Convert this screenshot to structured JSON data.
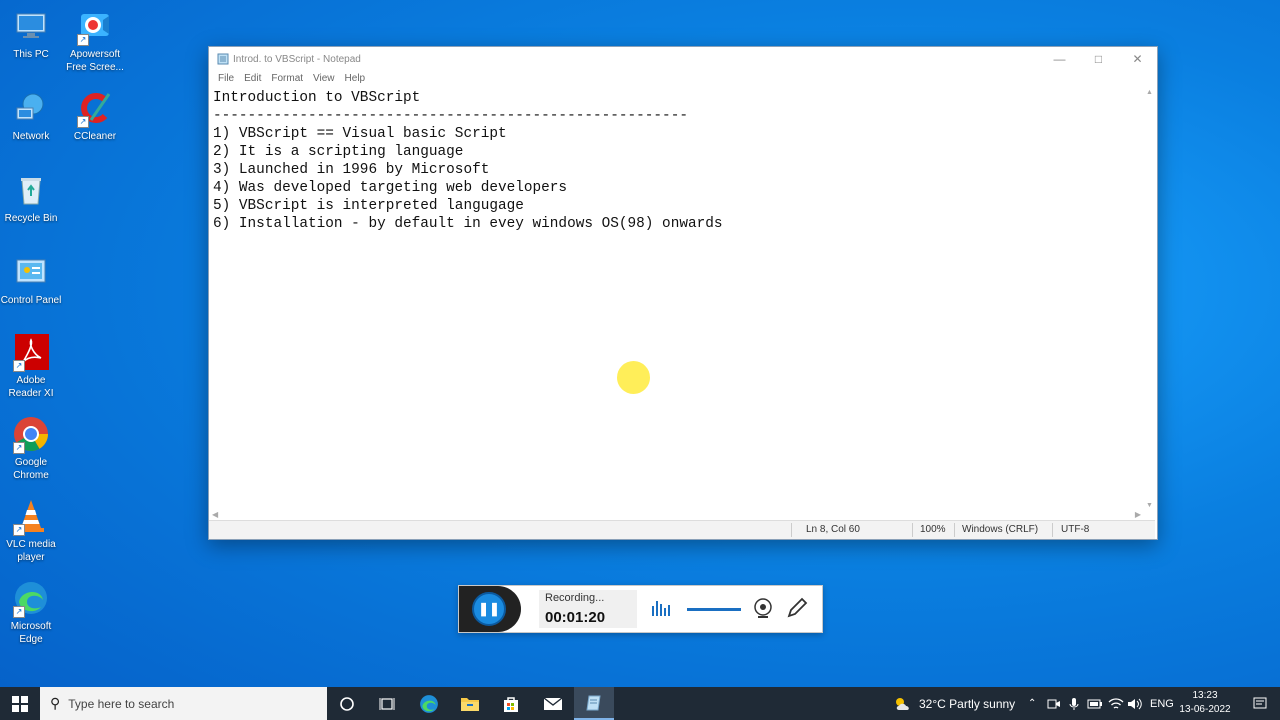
{
  "desktop": {
    "icons": [
      {
        "label": "This PC"
      },
      {
        "label": "Apowersoft Free Scree..."
      },
      {
        "label": "Network"
      },
      {
        "label": "CCleaner"
      },
      {
        "label": "Recycle Bin"
      },
      {
        "label": "Control Panel"
      },
      {
        "label": "Adobe Reader XI"
      },
      {
        "label": "Google Chrome"
      },
      {
        "label": "VLC media player"
      },
      {
        "label": "Microsoft Edge"
      }
    ]
  },
  "notepad": {
    "title": "Introd. to VBScript - Notepad",
    "menu": [
      "File",
      "Edit",
      "Format",
      "View",
      "Help"
    ],
    "content": "Introduction to VBScript\n-------------------------------------------------------\n1) VBScript == Visual basic Script\n2) It is a scripting language\n3) Launched in 1996 by Microsoft\n4) Was developed targeting web developers\n5) VBScript is interpreted langugage\n6) Installation - by default in evey windows OS(98) onwards",
    "status": {
      "position": "Ln 8, Col 60",
      "zoom": "100%",
      "line_ending": "Windows (CRLF)",
      "encoding": "UTF-8"
    }
  },
  "recorder": {
    "status": "Recording...",
    "time": "00:01:20"
  },
  "taskbar": {
    "search_placeholder": "Type here to search",
    "weather": "32°C  Partly sunny",
    "language": "ENG",
    "time": "13:23",
    "date": "13-06-2022"
  },
  "colors": {
    "desktop_bg": "#0a7fe0",
    "taskbar_bg": "#1f2a36",
    "accent": "#1a8be0"
  }
}
